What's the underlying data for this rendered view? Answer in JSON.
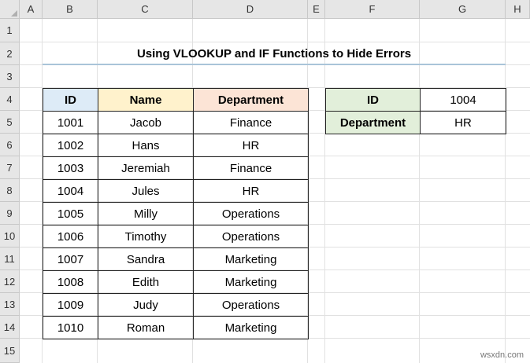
{
  "columns": [
    "A",
    "B",
    "C",
    "D",
    "E",
    "F",
    "G",
    "H"
  ],
  "rows": [
    "1",
    "2",
    "3",
    "4",
    "5",
    "6",
    "7",
    "8",
    "9",
    "10",
    "11",
    "12",
    "13",
    "14",
    "15"
  ],
  "title": "Using VLOOKUP and IF Functions to Hide Errors",
  "main_table": {
    "headers": [
      "ID",
      "Name",
      "Department"
    ],
    "rows": [
      [
        "1001",
        "Jacob",
        "Finance"
      ],
      [
        "1002",
        "Hans",
        "HR"
      ],
      [
        "1003",
        "Jeremiah",
        "Finance"
      ],
      [
        "1004",
        "Jules",
        "HR"
      ],
      [
        "1005",
        "Milly",
        "Operations"
      ],
      [
        "1006",
        "Timothy",
        "Operations"
      ],
      [
        "1007",
        "Sandra",
        "Marketing"
      ],
      [
        "1008",
        "Edith",
        "Marketing"
      ],
      [
        "1009",
        "Judy",
        "Operations"
      ],
      [
        "1010",
        "Roman",
        "Marketing"
      ]
    ]
  },
  "lookup_table": {
    "id_label": "ID",
    "id_value": "1004",
    "dept_label": "Department",
    "dept_value": "HR"
  },
  "watermark": "wsxdn.com",
  "colors": {
    "id_header": "#ddebf7",
    "name_header": "#fff2cc",
    "dept_header": "#fce4d6",
    "lookup_label": "#e2efda",
    "title_underline": "#a9c4d9"
  }
}
